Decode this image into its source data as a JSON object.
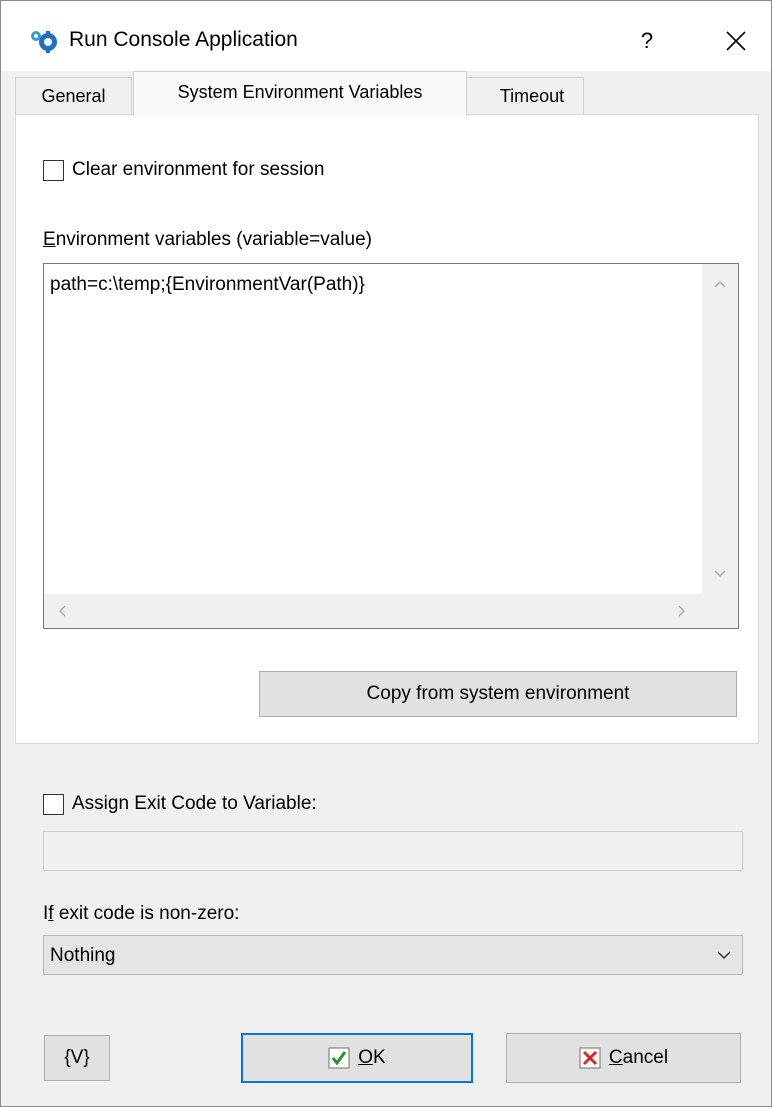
{
  "window": {
    "title": "Run Console Application",
    "help_label": "?",
    "icon": "run-console-app-icon",
    "close_icon": "close-icon"
  },
  "tabs": [
    {
      "label": "General",
      "active": false
    },
    {
      "label": "System Environment Variables",
      "active": true
    },
    {
      "label": "Timeout",
      "active": false
    }
  ],
  "env_tab": {
    "clear_env": {
      "label": "Clear environment for session",
      "checked": false
    },
    "env_vars_label_mnemonic": "E",
    "env_vars_label_rest": "nvironment variables (variable=value)",
    "env_vars_value": "path=c:\\temp;{EnvironmentVar(Path)}",
    "copy_button_label": "Copy from system environment"
  },
  "exit_code": {
    "assign_label": "Assign Exit Code to Variable:",
    "assign_checked": false,
    "variable_value": "",
    "nonzero_label_prefix": "I",
    "nonzero_label_mnemonic": "f",
    "nonzero_label_rest": " exit code is non-zero:",
    "nonzero_selected": "Nothing"
  },
  "buttons": {
    "variables_label": "{V}",
    "ok_mnemonic": "O",
    "ok_rest": "K",
    "cancel_mnemonic": "C",
    "cancel_rest": "ancel"
  },
  "colors": {
    "accent": "#0078d7",
    "ok_check": "#2e8b2e",
    "cancel_x": "#d62828"
  }
}
